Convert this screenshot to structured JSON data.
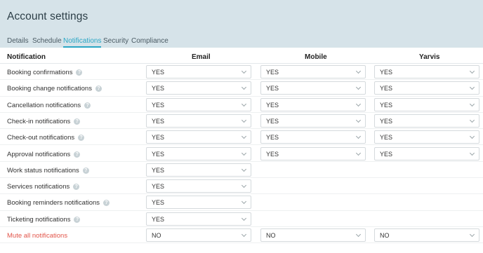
{
  "header": {
    "title": "Account settings",
    "tabs": [
      {
        "label": "Details",
        "active": false
      },
      {
        "label": "Schedule",
        "active": false
      },
      {
        "label": "Notifications",
        "active": true
      },
      {
        "label": "Security",
        "active": false
      },
      {
        "label": "Compliance",
        "active": false
      }
    ]
  },
  "table": {
    "columns": [
      "Notification",
      "Email",
      "Mobile",
      "Yarvis"
    ],
    "rows": [
      {
        "label": "Booking confirmations",
        "email": "YES",
        "mobile": "YES",
        "yarvis": "YES"
      },
      {
        "label": "Booking change notifications",
        "email": "YES",
        "mobile": "YES",
        "yarvis": "YES"
      },
      {
        "label": "Cancellation notifications",
        "email": "YES",
        "mobile": "YES",
        "yarvis": "YES"
      },
      {
        "label": "Check-in notifications",
        "email": "YES",
        "mobile": "YES",
        "yarvis": "YES"
      },
      {
        "label": "Check-out notifications",
        "email": "YES",
        "mobile": "YES",
        "yarvis": "YES"
      },
      {
        "label": "Approval notifications",
        "email": "YES",
        "mobile": "YES",
        "yarvis": "YES"
      },
      {
        "label": "Work status notifications",
        "email": "YES"
      },
      {
        "label": "Services notifications",
        "email": "YES"
      },
      {
        "label": "Booking reminders notifications",
        "email": "YES"
      },
      {
        "label": "Ticketing notifications",
        "email": "YES"
      },
      {
        "label": "Mute all notifications",
        "email": "NO",
        "mobile": "NO",
        "yarvis": "NO",
        "danger": true
      }
    ]
  },
  "colors": {
    "accent": "#2aa6c5",
    "header_bg": "#d6e3e9",
    "danger": "#e2554a"
  },
  "icons": {
    "info": "info-circle-icon",
    "dropdown": "chevron-down-icon"
  }
}
